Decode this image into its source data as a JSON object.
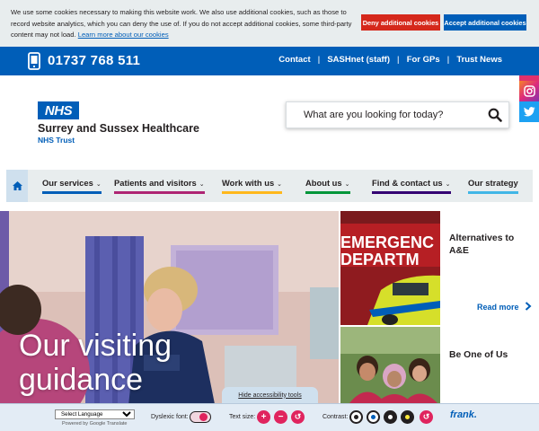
{
  "cookie_banner": {
    "text": "We use some cookies necessary to making this website work. We also use additional cookies, such as those to record website analytics, which you can deny the use of. If you do not accept additional cookies, some third-party content may not load.",
    "learn_more": "Learn more about our cookies",
    "deny_label": "Deny additional cookies",
    "accept_label": "Accept additional cookies"
  },
  "topbar": {
    "phone": "01737 768 511",
    "links": [
      "Contact",
      "SASHnet (staff)",
      "For GPs",
      "Trust News"
    ],
    "separator": "|"
  },
  "header": {
    "logo_text": "NHS",
    "org_name": "Surrey and Sussex Healthcare",
    "trust_label": "NHS Trust",
    "search_placeholder": "What are you looking for today?"
  },
  "nav": {
    "items": [
      {
        "label": "Our services",
        "color": "#005eb8"
      },
      {
        "label": "Patients and visitors",
        "color": "#ae2573"
      },
      {
        "label": "Work with us",
        "color": "#ffb81c"
      },
      {
        "label": "About us",
        "color": "#009639"
      },
      {
        "label": "Find & contact us",
        "color": "#330072"
      },
      {
        "label": "Our strategy",
        "color": "#41b6e6"
      }
    ],
    "chevron": "⌄"
  },
  "hero": {
    "title_line1": "Our visiting",
    "title_line2": "guidance"
  },
  "cards": [
    {
      "title": "Alternatives to A&E",
      "link": "Read more",
      "image_text": "EMERGENC DEPARTM"
    },
    {
      "title": "Be One of Us"
    }
  ],
  "accessibility": {
    "hide_label": "Hide accessibility tools",
    "language_select": "Select Language",
    "powered_by": "Powered by Google Translate",
    "dyslexic_label": "Dyslexic font:",
    "text_size_label": "Text size:",
    "contrast_label": "Contrast:",
    "plus": "+",
    "minus": "−",
    "reset": "↺",
    "frank_logo": "frank."
  },
  "colors": {
    "nhs_blue": "#005eb8",
    "deny_red": "#d5281b",
    "nav_bg": "#e8edee"
  }
}
